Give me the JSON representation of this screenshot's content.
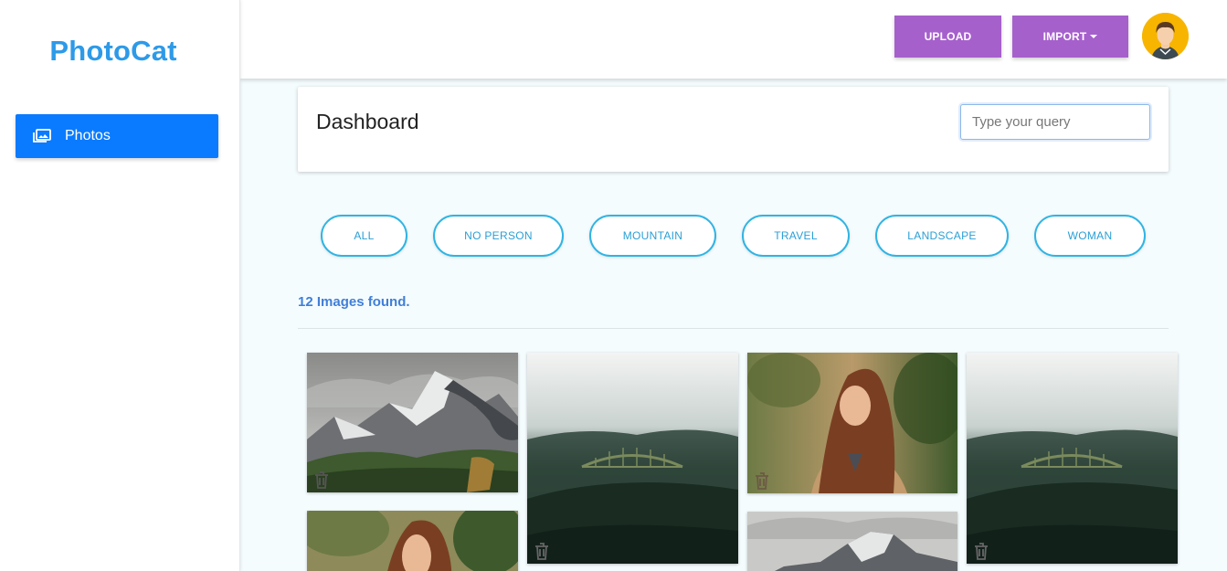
{
  "app": {
    "brand": "PhotoCat"
  },
  "sidebar": {
    "items": [
      {
        "label": "Photos",
        "icon": "photo-library-icon",
        "active": true
      }
    ]
  },
  "header": {
    "upload_label": "UPLOAD",
    "import_label": "IMPORT",
    "avatar_icon": "user-avatar-icon"
  },
  "dashboard": {
    "title": "Dashboard",
    "search_placeholder": "Type your query"
  },
  "filters": [
    "ALL",
    "NO PERSON",
    "MOUNTAIN",
    "TRAVEL",
    "LANDSCAPE",
    "WOMAN"
  ],
  "results": {
    "count_text": "12 Images found."
  },
  "photos": [
    {
      "subject": "mountain"
    },
    {
      "subject": "foggy-forest-bridge"
    },
    {
      "subject": "woman-portrait"
    },
    {
      "subject": "foggy-forest-bridge"
    },
    {
      "subject": "woman-portrait"
    },
    {
      "subject": "mountain"
    }
  ],
  "colors": {
    "brand": "#2d9ae8",
    "sidebar_active": "#0a7bff",
    "action_button": "#a660cc",
    "chip_border": "#2fb4e4",
    "count_text": "#3f7fd8",
    "main_bg": "#f5fcfe"
  }
}
